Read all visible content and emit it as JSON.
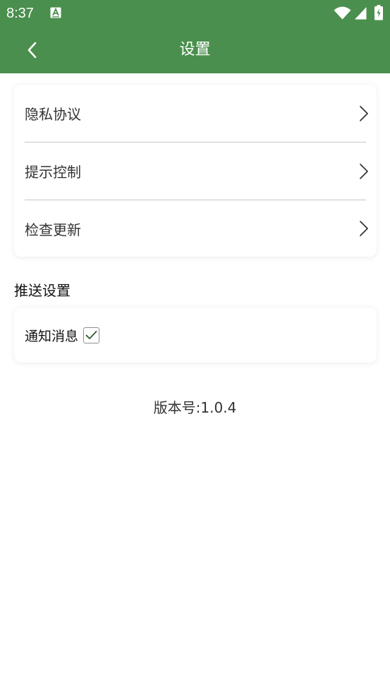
{
  "status_bar": {
    "time": "8:37",
    "icons": [
      "a-letter-icon",
      "wifi-icon",
      "signal-icon",
      "battery-charging-icon"
    ]
  },
  "header": {
    "title": "设置",
    "back_icon": "chevron-left-icon"
  },
  "settings_menu": {
    "items": [
      {
        "label": "隐私协议",
        "icon": "chevron-right-icon"
      },
      {
        "label": "提示控制",
        "icon": "chevron-right-icon"
      },
      {
        "label": "检查更新",
        "icon": "chevron-right-icon"
      }
    ]
  },
  "push_settings": {
    "heading": "推送设置",
    "notification": {
      "label": "通知消息",
      "checked": true,
      "icon": "checkmark-icon"
    }
  },
  "footer": {
    "version": "版本号:1.0.4"
  },
  "colors": {
    "primary": "#4b8f4e",
    "background": "#ffffff",
    "text": "#333333"
  }
}
